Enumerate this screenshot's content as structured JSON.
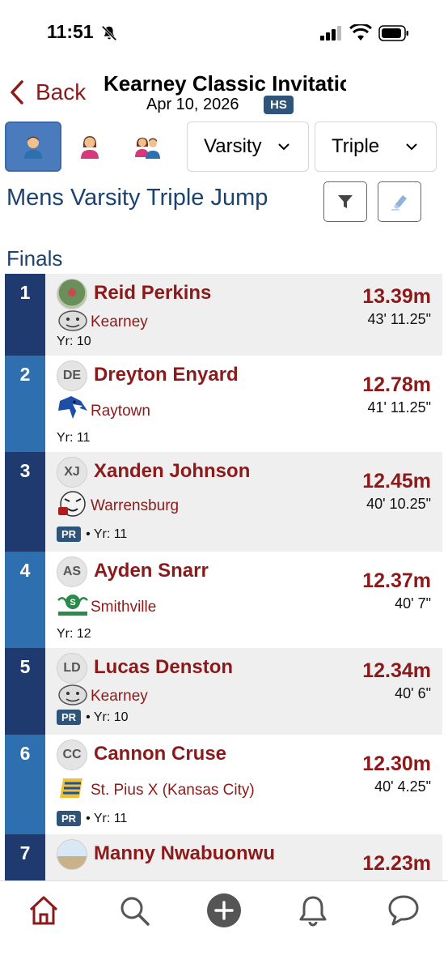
{
  "status_bar": {
    "time": "11:51"
  },
  "header": {
    "back_label": "Back",
    "meet_title": "Kearney Classic Invitational",
    "date": "Apr 10, 2026",
    "level_badge": "HS"
  },
  "filters": {
    "gender_options": [
      "male-icon",
      "female-icon",
      "mixed-icon"
    ],
    "selected_gender": "male",
    "division": "Varsity",
    "event": "Triple"
  },
  "event_title": "Mens Varsity Triple Jump",
  "section": "Finals",
  "results": [
    {
      "place": "1",
      "initials": "",
      "name": "Reid Perkins",
      "team": "Kearney",
      "pr": false,
      "year": "Yr: 10",
      "mark": "13.39m",
      "imperial": "43' 11.25\""
    },
    {
      "place": "2",
      "initials": "DE",
      "name": "Dreyton Enyard",
      "team": "Raytown",
      "pr": false,
      "year": "Yr: 11",
      "mark": "12.78m",
      "imperial": "41' 11.25\""
    },
    {
      "place": "3",
      "initials": "XJ",
      "name": "Xanden Johnson",
      "team": "Warrensburg",
      "pr": true,
      "pr_label": "PR",
      "year": "• Yr: 11",
      "mark": "12.45m",
      "imperial": "40' 10.25\""
    },
    {
      "place": "4",
      "initials": "AS",
      "name": "Ayden Snarr",
      "team": "Smithville",
      "pr": false,
      "year": "Yr: 12",
      "mark": "12.37m",
      "imperial": "40' 7\""
    },
    {
      "place": "5",
      "initials": "LD",
      "name": "Lucas Denston",
      "team": "Kearney",
      "pr": true,
      "pr_label": "PR",
      "year": "• Yr: 10",
      "mark": "12.34m",
      "imperial": "40' 6\""
    },
    {
      "place": "6",
      "initials": "CC",
      "name": "Cannon Cruse",
      "team": "St. Pius X (Kansas City)",
      "pr": true,
      "pr_label": "PR",
      "year": "• Yr: 11",
      "mark": "12.30m",
      "imperial": "40' 4.25\""
    },
    {
      "place": "7",
      "initials": "",
      "name": "Manny Nwabuonwu",
      "team": "",
      "pr": false,
      "year": "",
      "mark": "12.23m",
      "imperial": ""
    }
  ],
  "tabbar": [
    "home-icon",
    "search-icon",
    "add-icon",
    "notifications-icon",
    "messages-icon"
  ],
  "colors": {
    "maroon": "#8b1a1a",
    "navy": "#1e3a6e",
    "blue": "#2e6fb0",
    "title_blue": "#1c4270"
  }
}
